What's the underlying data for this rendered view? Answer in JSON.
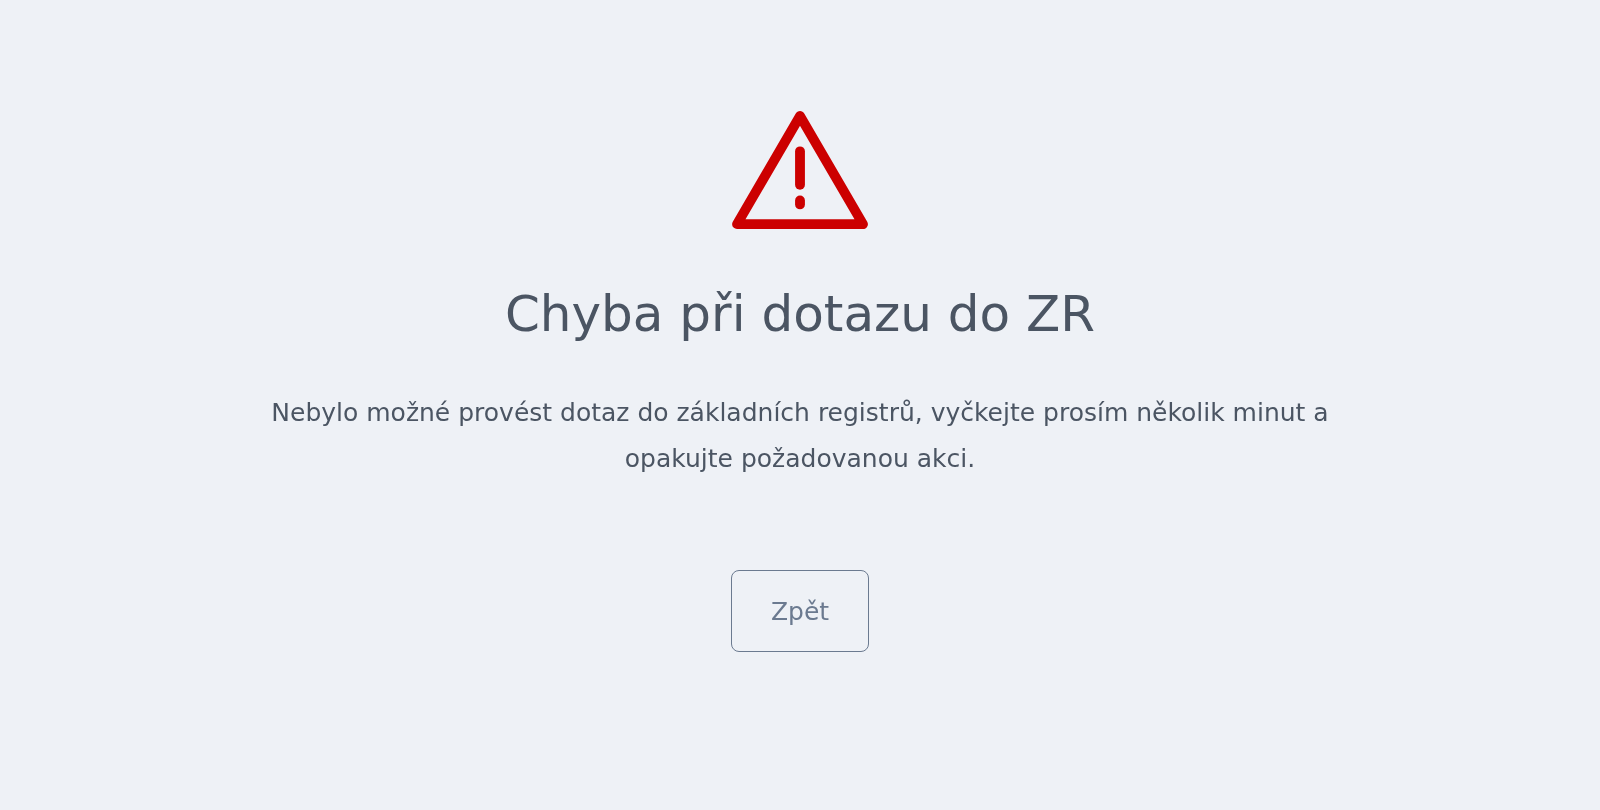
{
  "title": "Chyba při dotazu do ZR",
  "message": "Nebylo možné provést dotaz do základních registrů, vyčkejte prosím několik minut a opakujte požadovanou akci.",
  "button": "Zpět"
}
